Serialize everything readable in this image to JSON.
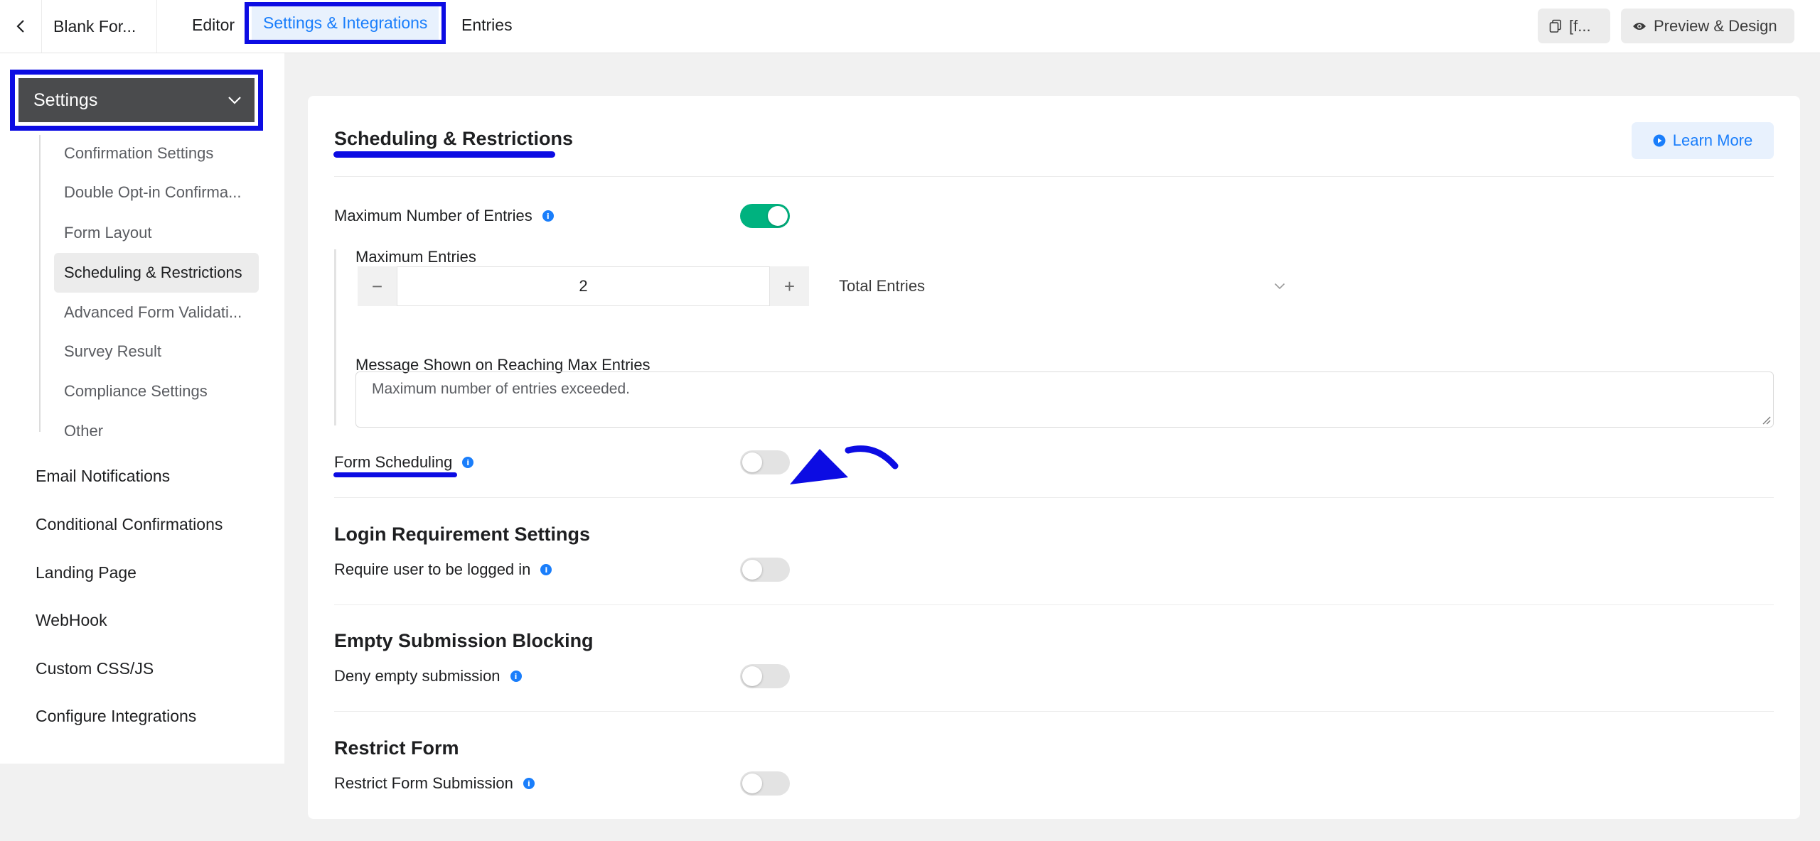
{
  "topbar": {
    "form_name": "Blank For...",
    "tabs": [
      {
        "label": "Editor"
      },
      {
        "label": "Settings & Integrations"
      },
      {
        "label": "Entries"
      }
    ],
    "shortcode_label": "[f...",
    "preview_label": "Preview & Design"
  },
  "sidebar": {
    "settings_label": "Settings",
    "sub_items": [
      {
        "label": "Confirmation Settings"
      },
      {
        "label": "Double Opt-in Confirma..."
      },
      {
        "label": "Form Layout"
      },
      {
        "label": "Scheduling & Restrictions"
      },
      {
        "label": "Advanced Form Validati..."
      },
      {
        "label": "Survey Result"
      },
      {
        "label": "Compliance Settings"
      },
      {
        "label": "Other"
      }
    ],
    "main_items": [
      {
        "label": "Email Notifications"
      },
      {
        "label": "Conditional Confirmations"
      },
      {
        "label": "Landing Page"
      },
      {
        "label": "WebHook"
      },
      {
        "label": "Custom CSS/JS"
      },
      {
        "label": "Configure Integrations"
      }
    ]
  },
  "main": {
    "title": "Scheduling & Restrictions",
    "learn_more_label": "Learn More",
    "max_entries_toggle_label": "Maximum Number of Entries",
    "max_entries_toggle_on": true,
    "max_entries_label": "Maximum Entries",
    "max_entries_value": "2",
    "stepper_minus": "−",
    "stepper_plus": "+",
    "period_select_value": "Total Entries",
    "message_label": "Message Shown on Reaching Max Entries",
    "message_value": "Maximum number of entries exceeded.",
    "form_scheduling_label": "Form Scheduling",
    "form_scheduling_on": false,
    "login_section_title": "Login Requirement Settings",
    "login_label": "Require user to be logged in",
    "login_on": false,
    "empty_section_title": "Empty Submission Blocking",
    "empty_label": "Deny empty submission",
    "empty_on": false,
    "restrict_section_title": "Restrict Form",
    "restrict_label": "Restrict Form Submission",
    "restrict_on": false
  },
  "colors": {
    "accent": "#1a7efb",
    "toggle_on": "#00b27f",
    "annotation": "#0c0ce3",
    "sidebar_active_head": "#4a4b4d"
  }
}
